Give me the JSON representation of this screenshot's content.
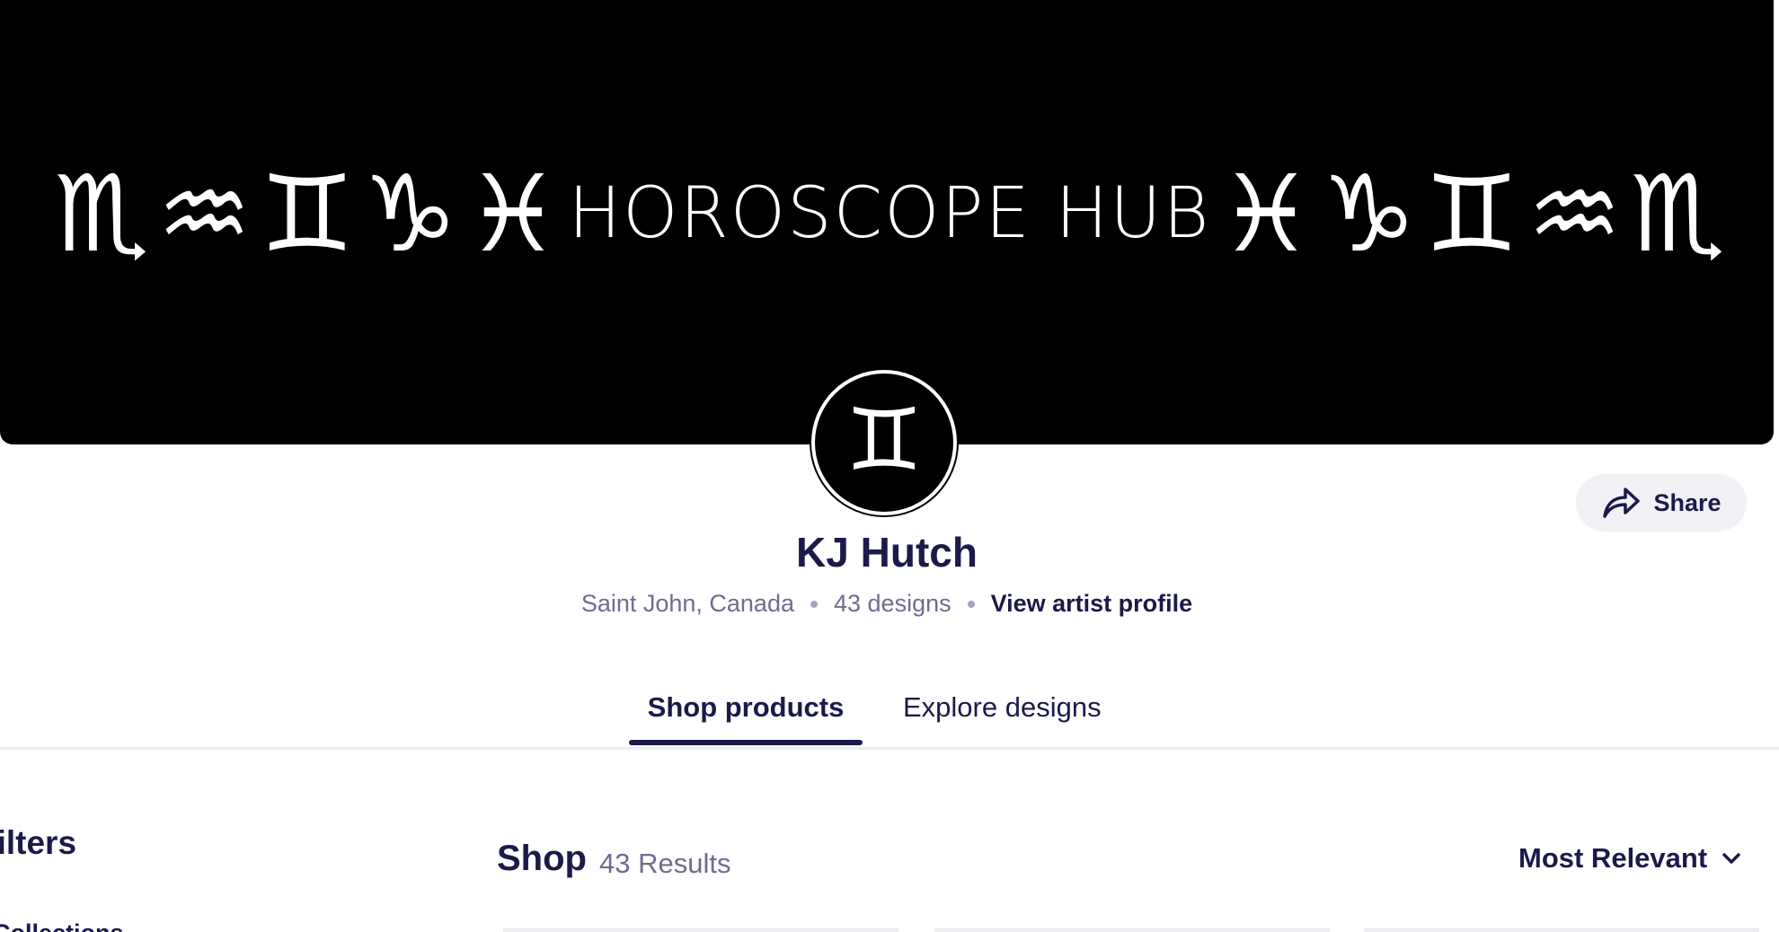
{
  "banner": {
    "title": "HOROSCOPE HUB",
    "left_symbols": [
      "♏",
      "♒",
      "♊",
      "♑",
      "♓"
    ],
    "right_symbols": [
      "♓",
      "♑",
      "♊",
      "♒",
      "♏"
    ],
    "background_color": "#000000"
  },
  "avatar": {
    "symbol": "♊"
  },
  "share": {
    "label": "Share",
    "icon": "share-arrow-icon"
  },
  "artist": {
    "name": "KJ Hutch",
    "location": "Saint John, Canada",
    "designs_count": "43 designs",
    "profile_link": "View artist profile"
  },
  "tabs": [
    {
      "label": "Shop products",
      "active": true
    },
    {
      "label": "Explore designs",
      "active": false
    }
  ],
  "filters": {
    "title": "Filters",
    "first_section": "Collections"
  },
  "shop": {
    "title": "Shop",
    "results": "43 Results",
    "sort_label": "Most Relevant",
    "sort_icon": "chevron-down-icon"
  },
  "colors": {
    "primary_text": "#1b1a4a",
    "secondary_text": "#6e6d8f",
    "share_bg": "#f1f1f6",
    "divider": "#ececf1"
  }
}
